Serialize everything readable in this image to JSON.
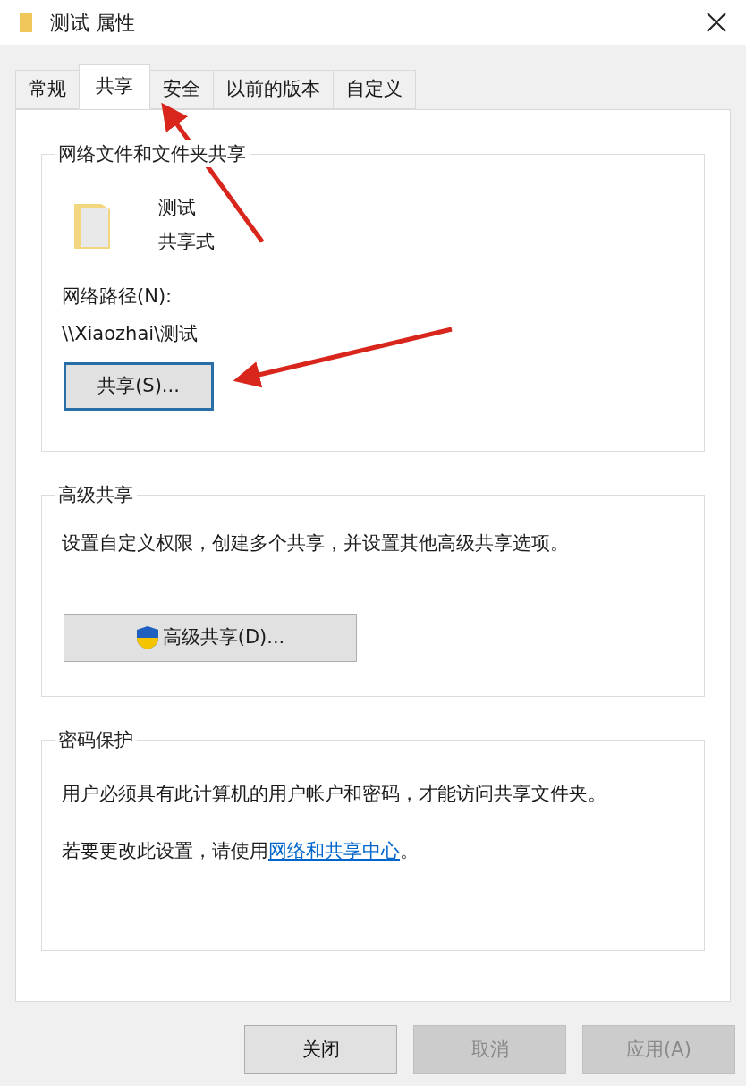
{
  "window": {
    "title": "测试 属性"
  },
  "tabs": [
    {
      "label": "常规",
      "selected": false
    },
    {
      "label": "共享",
      "selected": true
    },
    {
      "label": "安全",
      "selected": false
    },
    {
      "label": "以前的版本",
      "selected": false
    },
    {
      "label": "自定义",
      "selected": false
    }
  ],
  "network_sharing": {
    "title": "网络文件和文件夹共享",
    "folder_name": "测试",
    "folder_status": "共享式",
    "path_label": "网络路径(N):",
    "path": "\\\\Xiaozhai\\测试",
    "button": {
      "label": "共享(S)...",
      "focused": true
    }
  },
  "advanced_sharing": {
    "title": "高级共享",
    "description": "设置自定义权限，创建多个共享，并设置其他高级共享选项。",
    "button": {
      "label": "高级共享(D)...",
      "focused": false
    }
  },
  "password_protection": {
    "title": "密码保护",
    "description": "用户必须具有此计算机的用户帐户和密码，才能访问共享文件夹。",
    "hint_before": "若要更改此设置，请使用",
    "link": "网络和共享中心",
    "hint_after": "。"
  },
  "buttons": [
    {
      "label": "关闭",
      "disabled": false
    },
    {
      "label": "取消",
      "disabled": true
    },
    {
      "label": "应用(A)",
      "disabled": true
    }
  ]
}
